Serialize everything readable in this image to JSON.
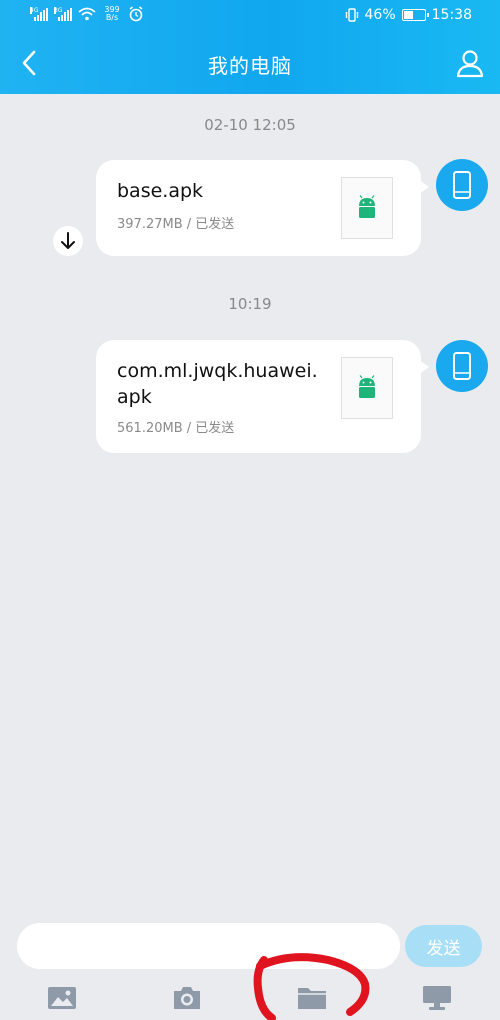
{
  "status_bar": {
    "signal1_tag": "4G",
    "signal2_tag": "3G",
    "net_speed_value": "399",
    "net_speed_unit": "B/s",
    "battery_percent": "46%",
    "battery_level": 0.46,
    "time": "15:38"
  },
  "header": {
    "title": "我的电脑",
    "back_icon": "chevron-left-icon",
    "profile_icon": "person-icon"
  },
  "messages": [
    {
      "timestamp": "02-10 12:05",
      "file_name": "base.apk",
      "meta": "397.27MB / 已发送",
      "thumb_icon": "android-icon",
      "avatar_icon": "phone-icon",
      "has_download": true
    },
    {
      "timestamp": "10:19",
      "file_name": "com.ml.jwqk.huawei.apk",
      "meta": "561.20MB / 已发送",
      "thumb_icon": "android-icon",
      "avatar_icon": "phone-icon",
      "has_download": false
    }
  ],
  "input": {
    "value": "",
    "placeholder": ""
  },
  "send_label": "发送",
  "toolbar": {
    "items": [
      "image-icon",
      "camera-icon",
      "folder-icon",
      "computer-icon"
    ]
  },
  "colors": {
    "header": "#1fb3f2",
    "avatar": "#1aa9ee",
    "android": "#1fb57a",
    "send_disabled": "#a9def7",
    "background": "#e9ebef",
    "annotation": "#e0141e"
  }
}
